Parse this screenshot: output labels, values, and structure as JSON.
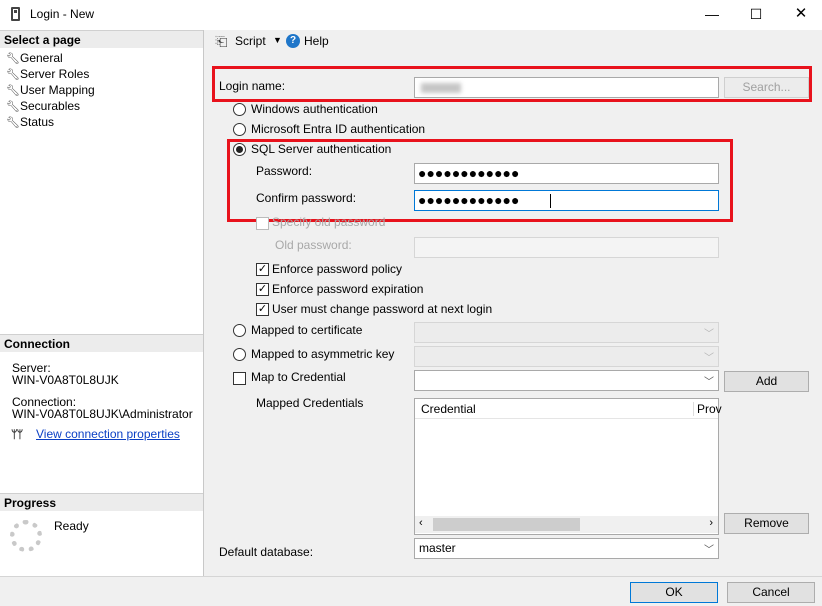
{
  "window": {
    "title": "Login - New",
    "minimize": "—",
    "maximize": "☐",
    "close": "✕"
  },
  "left": {
    "select_page_header": "Select a page",
    "pages": [
      {
        "label": "General"
      },
      {
        "label": "Server Roles"
      },
      {
        "label": "User Mapping"
      },
      {
        "label": "Securables"
      },
      {
        "label": "Status"
      }
    ],
    "connection_header": "Connection",
    "server_label": "Server:",
    "server_value": "WIN-V0A8T0L8UJK",
    "connection_label": "Connection:",
    "connection_value": "WIN-V0A8T0L8UJK\\Administrator",
    "view_connection_link": "View connection properties",
    "progress_header": "Progress",
    "progress_status": "Ready"
  },
  "toolbar": {
    "script_label": "Script",
    "help_label": "Help"
  },
  "form": {
    "login_name_label": "Login name:",
    "search_button": "Search...",
    "windows_auth": "Windows authentication",
    "entra_auth": "Microsoft Entra ID authentication",
    "sql_auth": "SQL Server authentication",
    "password_label": "Password:",
    "password_mask": "●●●●●●●●●●●●",
    "confirm_password_label": "Confirm password:",
    "confirm_password_mask": "●●●●●●●●●●●●",
    "specify_old_password": "Specify old password",
    "old_password_label": "Old password:",
    "enforce_policy": "Enforce password policy",
    "enforce_expiration": "Enforce password expiration",
    "must_change": "User must change password at next login",
    "mapped_certificate": "Mapped to certificate",
    "mapped_asym_key": "Mapped to asymmetric key",
    "map_credential": "Map to Credential",
    "add_button": "Add",
    "mapped_credentials_label": "Mapped Credentials",
    "credential_col": "Credential",
    "provider_col": "Prov",
    "remove_button": "Remove",
    "default_db_label": "Default database:",
    "default_db_value": "master"
  },
  "footer": {
    "ok_button": "OK",
    "cancel_button": "Cancel"
  },
  "colors": {
    "highlight_red": "#e8121c",
    "link_blue": "#0a3fc4",
    "focus_blue": "#0078d7"
  }
}
